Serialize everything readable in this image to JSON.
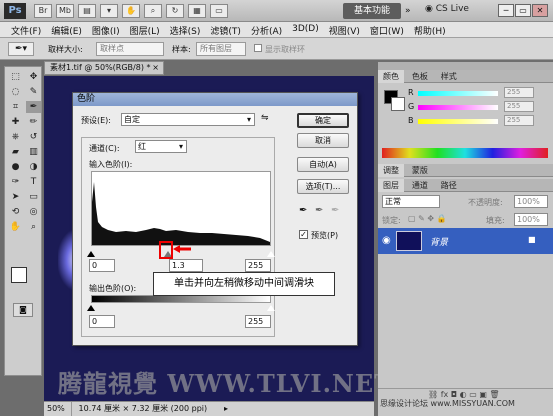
{
  "app": {
    "logo": "Ps",
    "workspace_button": "基本功能",
    "cs_live": "CS Live"
  },
  "menu": [
    "文件(F)",
    "编辑(E)",
    "图像(I)",
    "图层(L)",
    "选择(S)",
    "滤镜(T)",
    "分析(A)",
    "3D(D)",
    "视图(V)",
    "窗口(W)",
    "帮助(H)"
  ],
  "options_bar": {
    "sample_size_label": "取样大小:",
    "sample_size_value": "取样点",
    "sample_label": "样本:",
    "sample_value": "所有图层",
    "show_ring_label": "显示取样环"
  },
  "document": {
    "tab_title": "素材1.tif @ 50%(RGB/8) *",
    "zoom": "50%",
    "dimensions": "10.74 厘米 × 7.32 厘米 (200 ppi)"
  },
  "panels": {
    "color_tabs": [
      "颜色",
      "色板",
      "样式"
    ],
    "channels": [
      {
        "label": "R",
        "value": "255"
      },
      {
        "label": "G",
        "value": "255"
      },
      {
        "label": "B",
        "value": "255"
      }
    ],
    "adjust_tabs": [
      "调整",
      "蒙版"
    ],
    "layer_tabs": [
      "图层",
      "通道",
      "路径"
    ],
    "blend_mode": "正常",
    "opacity_label": "不透明度:",
    "opacity_value": "100%",
    "lock_label": "锁定:",
    "fill_label": "填充:",
    "fill_value": "100%",
    "layer_name": "背景"
  },
  "dialog": {
    "title": "色阶",
    "preset_label": "预设(E):",
    "preset_value": "自定",
    "channel_group": "通道(C):",
    "channel_value": "红",
    "input_levels_label": "输入色阶(I):",
    "input_black": "0",
    "input_gamma": "1.3",
    "input_white": "255",
    "output_levels_label": "输出色阶(O):",
    "output_black": "0",
    "output_white": "255",
    "buttons": {
      "ok": "确定",
      "cancel": "取消",
      "auto": "自动(A)",
      "options": "选项(T)..."
    },
    "preview_label": "预览(P)",
    "preview_checked": true
  },
  "annotation": {
    "callout": "单击并向左稍微移动中间调滑块"
  },
  "watermark": "腾龍視覺 WWW.TLVI.NET",
  "site_credit": "思缘设计论坛 www.MISSYUAN.COM"
}
